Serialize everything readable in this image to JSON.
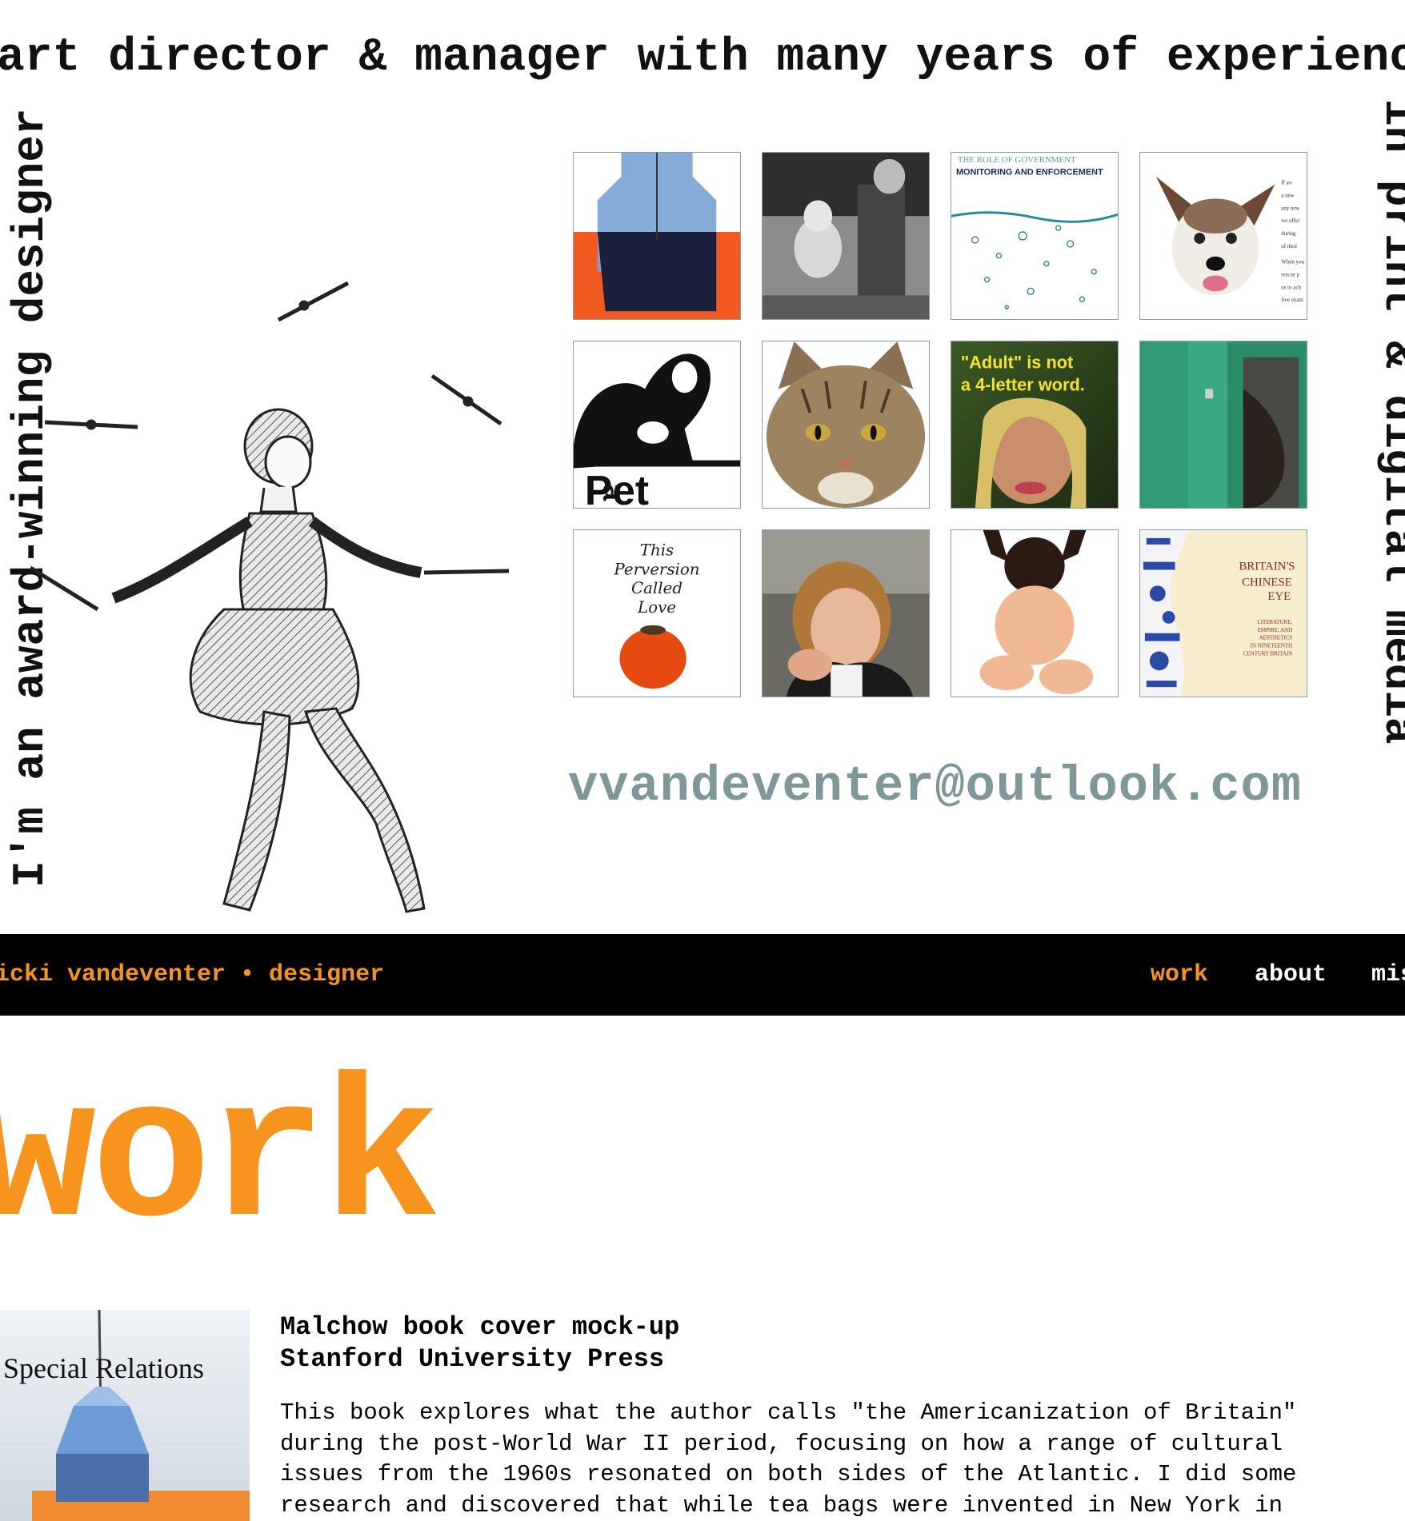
{
  "hero": {
    "top_text": "art director & manager with many years of experience",
    "left_text": "I'm an award-winning designer",
    "right_text": "in print & digital media",
    "email": "vvandeventer@outlook.com",
    "tiles": [
      {
        "name": "tile-tea-bag",
        "label": ""
      },
      {
        "name": "tile-vintage-photo",
        "label": ""
      },
      {
        "name": "tile-government",
        "label": "MONITORING AND ENFORCEMENT",
        "sub": "THE ROLE OF GOVERNMENT"
      },
      {
        "name": "tile-dog",
        "label": ""
      },
      {
        "name": "tile-pet-logo",
        "label": "Pet"
      },
      {
        "name": "tile-cat",
        "label": ""
      },
      {
        "name": "tile-adult",
        "label": "\"Adult\" is not a 4-letter word."
      },
      {
        "name": "tile-green-door",
        "label": ""
      },
      {
        "name": "tile-perversion",
        "label": "This Perversion Called Love"
      },
      {
        "name": "tile-portrait",
        "label": ""
      },
      {
        "name": "tile-baby-doll",
        "label": ""
      },
      {
        "name": "tile-chinese-eye",
        "label": "BRITAIN'S CHINESE EYE",
        "sub": "LITERATURE, EMPIRE, AND AESTHETICS IN NINETEENTH CENTURY BRITAIN"
      }
    ]
  },
  "nav": {
    "brand": "vicki vandeventer • designer",
    "links": [
      "work",
      "about",
      "misc"
    ]
  },
  "page": {
    "heading": "work"
  },
  "project": {
    "thumb_title": "Special Relations",
    "title_line1": "Malchow book cover mock-up",
    "title_line2": "Stanford University Press",
    "desc_lines": [
      "This book explores what the author calls \"the Americanization of Britain\"",
      "during the post-World War II period, focusing on how a range of cultural",
      "issues from the 1960s resonated on both sides of the Atlantic. I did some",
      "research and discovered that while tea bags were invented in New York in"
    ]
  },
  "colors": {
    "accent": "#f7941d",
    "email": "#7f9797",
    "nav_bg": "#000000"
  }
}
